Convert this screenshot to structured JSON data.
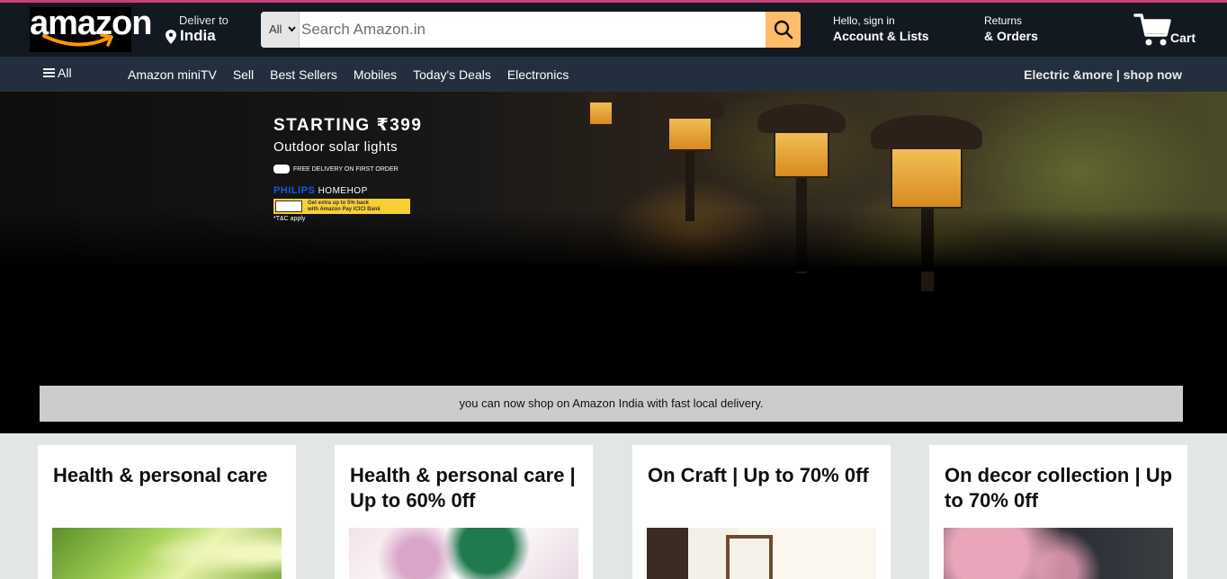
{
  "header": {
    "logo_text": "amazon",
    "deliver_label": "Deliver to",
    "deliver_country": "India",
    "search": {
      "category": "All",
      "placeholder": "Search Amazon.in"
    },
    "signin_line1": "Hello, sign in",
    "signin_line2": "Account & Lists",
    "returns_line1": "Returns",
    "returns_line2": "& Orders",
    "cart_label": "Cart"
  },
  "nav": {
    "all_label": "All",
    "items": [
      {
        "label": "Amazon miniTV"
      },
      {
        "label": "Sell"
      },
      {
        "label": "Best Sellers"
      },
      {
        "label": "Mobiles"
      },
      {
        "label": "Today's Deals"
      },
      {
        "label": "Electronics"
      }
    ],
    "promo": "Electric &more | shop now"
  },
  "hero": {
    "headline": "STARTING ₹399",
    "subheadline": "Outdoor solar lights",
    "delivery": "FREE DELIVERY ON FIRST ORDER",
    "brand_philips": "PHILIPS",
    "brand_homehop": "HOMEHOP",
    "offer_line1": "Get extra up to 5% back",
    "offer_line2": "with Amazon Pay ICICI Bank",
    "tc": "*T&C apply",
    "notice": "you can now shop on Amazon India with fast local delivery."
  },
  "cards": [
    {
      "title": "Health & personal care"
    },
    {
      "title": "Health & personal care | Up to 60% 0ff"
    },
    {
      "title": "On Craft | Up to 70% 0ff"
    },
    {
      "title": "On decor collection | Up to 70% 0ff"
    }
  ],
  "colors": {
    "header_bg": "#131921",
    "nav_bg": "#232f3e",
    "search_button": "#febd69",
    "top_strip": "#c7407a"
  }
}
